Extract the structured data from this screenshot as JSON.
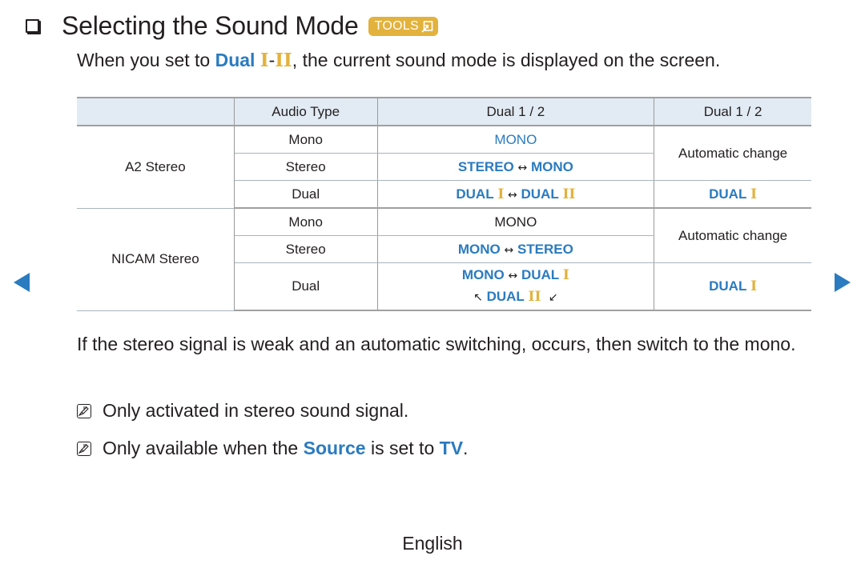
{
  "heading": {
    "title": "Selecting the Sound Mode",
    "badge": "TOOLS",
    "checkbox_icon": "checkbox-square-icon",
    "badge_icon": "tools-arrow-icon"
  },
  "intro": {
    "before": "When you set to ",
    "highlight": "Dual",
    "roman1": "I",
    "dash": "-",
    "roman2": "II",
    "after": ", the current sound mode is displayed on the screen."
  },
  "table": {
    "headers": [
      "",
      "Audio Type",
      "Dual 1 / 2",
      "Dual 1 / 2"
    ],
    "groups": [
      {
        "name": "A2 Stereo",
        "rows": [
          {
            "audio_type": "Mono",
            "dual12": "MONO",
            "auto": "Automatic change"
          },
          {
            "audio_type": "Stereo",
            "dual12_a": "STEREO",
            "dual12_arrow": "↔",
            "dual12_b": "MONO"
          },
          {
            "audio_type": "Dual",
            "dual12_a": "DUAL",
            "dual12_a_num": "I",
            "dual12_arrow": "↔",
            "dual12_b": "DUAL",
            "dual12_b_num": "II",
            "auto": "DUAL",
            "auto_num": "I"
          }
        ]
      },
      {
        "name": "NICAM Stereo",
        "rows": [
          {
            "audio_type": "Mono",
            "dual12": "MONO",
            "auto": "Automatic change"
          },
          {
            "audio_type": "Stereo",
            "dual12_a": "MONO",
            "dual12_arrow": "↔",
            "dual12_b": "STEREO"
          },
          {
            "audio_type": "Dual",
            "line1_a": "MONO",
            "line1_arrow": "↔",
            "line1_b": "DUAL",
            "line1_b_num": "I",
            "line2_left": "↖",
            "line2_text": "DUAL",
            "line2_num": "II",
            "line2_right": "↙",
            "auto": "DUAL",
            "auto_num": "I"
          }
        ]
      }
    ]
  },
  "paragraph": "If the stereo signal is weak and an automatic switching, occurs, then switch to the mono.",
  "notes": [
    {
      "icon": "note-icon",
      "text": "Only activated in stereo sound signal."
    },
    {
      "icon": "note-icon",
      "before": "Only available when the ",
      "source": "Source",
      "middle": " is set to ",
      "tv": "TV",
      "after": "."
    }
  ],
  "navigation": {
    "prev": "previous-page-icon",
    "next": "next-page-icon"
  },
  "footer": {
    "language": "English"
  },
  "colors": {
    "accent_blue": "#2a7bbf",
    "accent_gold": "#e3b23c",
    "header_bg": "#e2ebf3",
    "text": "#231f20"
  }
}
